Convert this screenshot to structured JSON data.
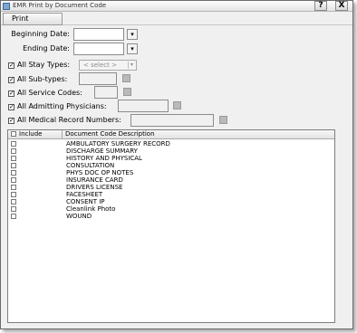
{
  "window": {
    "title": "EMR Print by Document Code",
    "help_button": "?",
    "close_button": "X"
  },
  "toolbar": {
    "print_label": "Print"
  },
  "form": {
    "beginning_date_label": "Beginning Date:",
    "ending_date_label": "Ending Date:",
    "all_stay_types_label": "All Stay Types:",
    "stay_types_placeholder": "< select >",
    "all_sub_types_label": "All Sub-types:",
    "all_service_codes_label": "All Service Codes:",
    "all_admitting_physicians_label": "All Admitting Physicians:",
    "all_medical_record_numbers_label": "All Medical Record Numbers:"
  },
  "grid": {
    "columns": [
      "Include",
      "Document Code Description"
    ],
    "rows": [
      "AMBULATORY SURGERY RECORD",
      "DISCHARGE SUMMARY",
      "HISTORY AND PHYSICAL",
      "CONSULTATION",
      "PHYS DOC OP NOTES",
      "INSURANCE CARD",
      "DRIVERS LICENSE",
      "FACESHEET",
      "CONSENT IP",
      "Cleanlink Photo",
      "WOUND"
    ]
  }
}
